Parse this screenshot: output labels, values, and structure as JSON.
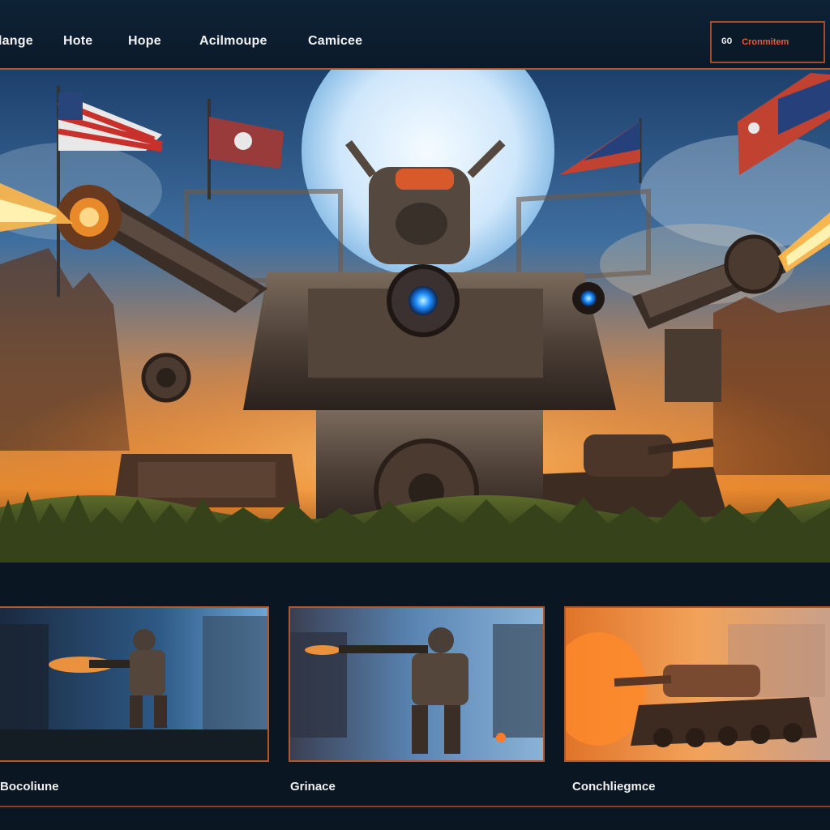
{
  "nav": {
    "items": [
      {
        "label": "lange"
      },
      {
        "label": "Hote"
      },
      {
        "label": "Hope"
      },
      {
        "label": "Acilmoupe"
      },
      {
        "label": "Camicee"
      }
    ],
    "cta": {
      "icon": "gamepad-icon",
      "icon_text": "GO",
      "label": "Cronmitem"
    }
  },
  "hero": {
    "scene": "battle-mech-scene"
  },
  "cards": [
    {
      "label": "Bocoliune",
      "scene": "soldier-firing-gun"
    },
    {
      "label": "Grinace",
      "scene": "soldier-aiming-rifle"
    },
    {
      "label": "Conchliegmce",
      "scene": "tank-in-fire"
    }
  ],
  "colors": {
    "accent": "#b4582a",
    "background": "#0a1622",
    "cta_text": "#e85a3a"
  }
}
